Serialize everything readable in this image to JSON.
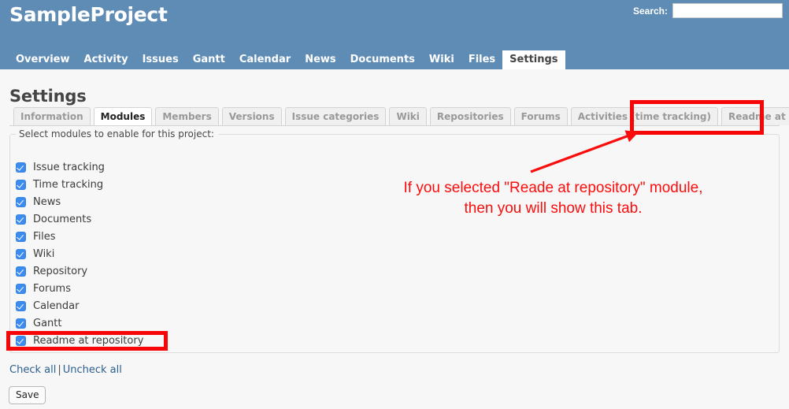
{
  "header": {
    "project_title": "SampleProject",
    "search_label": "Search:",
    "search_value": "",
    "search_placeholder": ""
  },
  "main_menu": {
    "items": [
      {
        "label": "Overview",
        "selected": false
      },
      {
        "label": "Activity",
        "selected": false
      },
      {
        "label": "Issues",
        "selected": false
      },
      {
        "label": "Gantt",
        "selected": false
      },
      {
        "label": "Calendar",
        "selected": false
      },
      {
        "label": "News",
        "selected": false
      },
      {
        "label": "Documents",
        "selected": false
      },
      {
        "label": "Wiki",
        "selected": false
      },
      {
        "label": "Files",
        "selected": false
      },
      {
        "label": "Settings",
        "selected": true
      }
    ]
  },
  "page": {
    "title": "Settings"
  },
  "settings_tabs": {
    "items": [
      {
        "label": "Information",
        "selected": false
      },
      {
        "label": "Modules",
        "selected": true
      },
      {
        "label": "Members",
        "selected": false
      },
      {
        "label": "Versions",
        "selected": false
      },
      {
        "label": "Issue categories",
        "selected": false
      },
      {
        "label": "Wiki",
        "selected": false
      },
      {
        "label": "Repositories",
        "selected": false
      },
      {
        "label": "Forums",
        "selected": false
      },
      {
        "label": "Activities (time tracking)",
        "selected": false
      },
      {
        "label": "Readme at Repository",
        "selected": false
      }
    ]
  },
  "modules": {
    "legend": "Select modules to enable for this project:",
    "items": [
      {
        "label": "Issue tracking",
        "checked": true
      },
      {
        "label": "Time tracking",
        "checked": true
      },
      {
        "label": "News",
        "checked": true
      },
      {
        "label": "Documents",
        "checked": true
      },
      {
        "label": "Files",
        "checked": true
      },
      {
        "label": "Wiki",
        "checked": true
      },
      {
        "label": "Repository",
        "checked": true
      },
      {
        "label": "Forums",
        "checked": true
      },
      {
        "label": "Calendar",
        "checked": true
      },
      {
        "label": "Gantt",
        "checked": true
      },
      {
        "label": "Readme at repository",
        "checked": true
      }
    ]
  },
  "actions": {
    "check_all": "Check all",
    "separator": "|",
    "uncheck_all": "Uncheck all",
    "save": "Save"
  },
  "annotation": {
    "text": "If you selected \"Reade at repository\" module,\nthen you will show this tab.",
    "color": "#fa0d0d",
    "highlight_tab": "Readme at Repository",
    "highlight_checkbox": "Readme at repository"
  },
  "colors": {
    "header_blue": "#5f8cb5",
    "content_bg": "#f7f7f7",
    "checkbox_blue": "#3c8cf0",
    "link_blue": "#2a5f8f",
    "annotation_red": "#fa0d0d"
  }
}
